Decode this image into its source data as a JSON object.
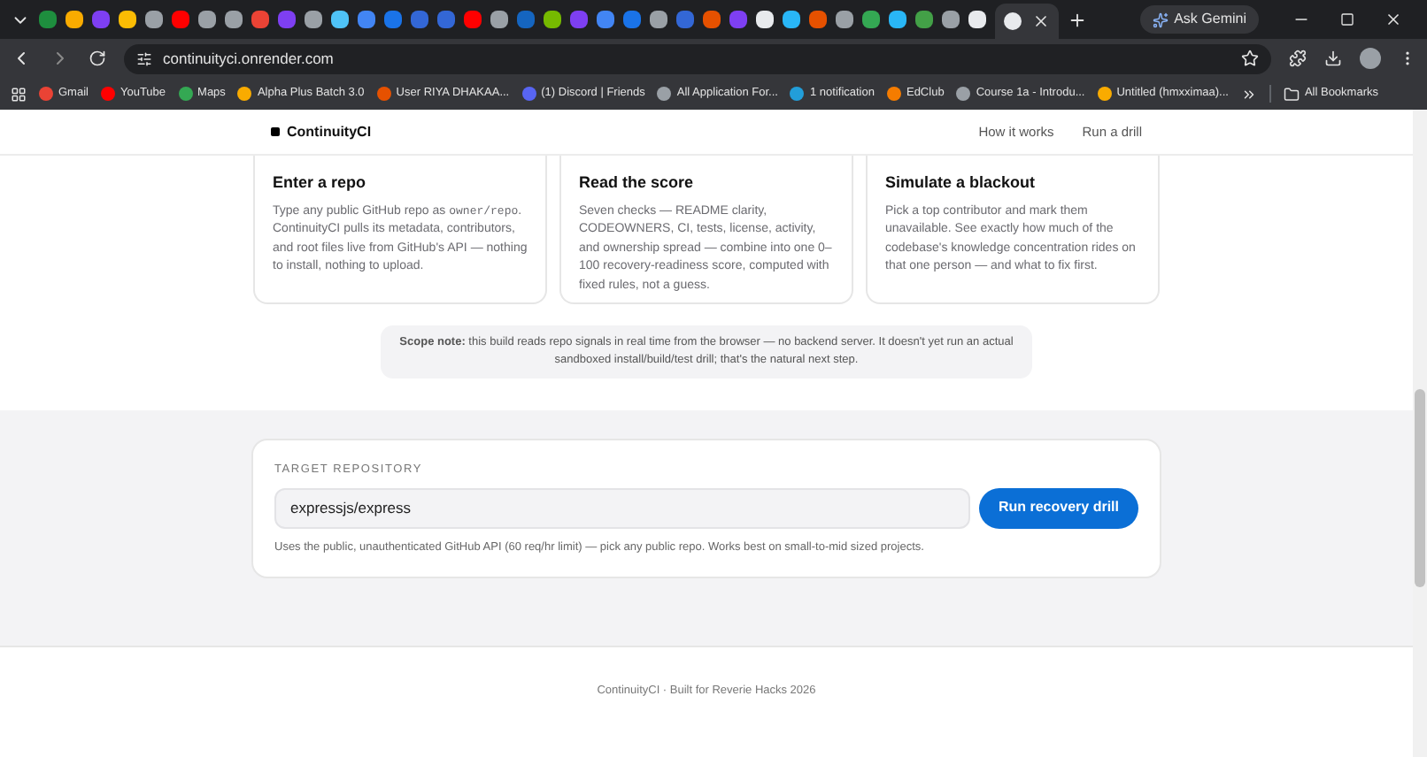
{
  "browser": {
    "gemini_button": "Ask Gemini",
    "url": "continuityci.onrender.com",
    "bookmarks": [
      "Gmail",
      "YouTube",
      "Maps",
      "Alpha Plus Batch 3.0",
      "User RIYA DHAKAA...",
      "(1) Discord | Friends",
      "All Application For...",
      "1 notification",
      "EdClub",
      "Course 1a - Introdu...",
      "Untitled (hmxximaa)..."
    ],
    "all_bookmarks": "All Bookmarks"
  },
  "nav": {
    "brand": "ContinuityCI",
    "links": [
      "How it works",
      "Run a drill"
    ]
  },
  "steps": [
    {
      "title": "Enter a repo",
      "body": [
        {
          "kind": "text",
          "text": "Type any public GitHub repo as "
        },
        {
          "kind": "code",
          "text": "owner/repo"
        },
        {
          "kind": "text",
          "text": ". ContinuityCI pulls its metadata, contributors, and root files live from GitHub's API — nothing to install, nothing to upload."
        }
      ]
    },
    {
      "title": "Read the score",
      "body": [
        {
          "kind": "text",
          "text": "Seven checks — README clarity, CODEOWNERS, CI, tests, license, activity, and ownership spread — combine into one 0–100 recovery-readiness score, computed with fixed rules, not a guess."
        }
      ]
    },
    {
      "title": "Simulate a blackout",
      "body": [
        {
          "kind": "text",
          "text": "Pick a top contributor and mark them unavailable. See exactly how much of the codebase's knowledge concentration rides on that one person — and what to fix first."
        }
      ]
    }
  ],
  "scope_note": "**Scope note:** this build reads repo signals in real time from the browser — no backend server. It doesn't yet run an actual sandboxed install/build/test drill; that's the natural next step.",
  "drill": {
    "label": "TARGET REPOSITORY",
    "value": "expressjs/express",
    "button": "Run recovery drill",
    "hint": "Uses the public, unauthenticated GitHub API (60 req/hr limit) — pick any public repo. Works best on small-to-mid sized projects."
  },
  "footer": "ContinuityCI · Built for Reverie Hacks 2026"
}
